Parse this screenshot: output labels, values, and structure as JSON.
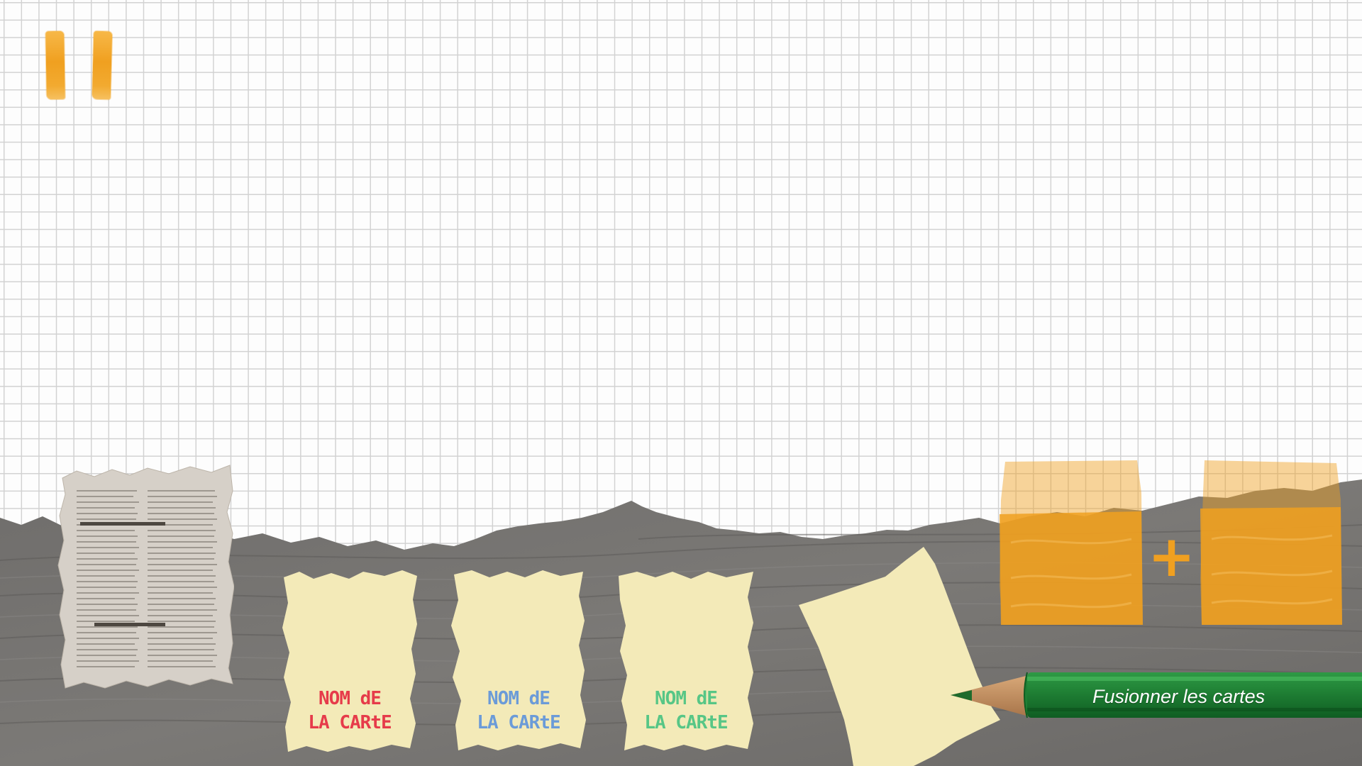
{
  "pause_button": {
    "icon": "pause-icon"
  },
  "deck": {
    "icon": "newspaper-card-icon"
  },
  "hand": {
    "cards": [
      {
        "label_line1": "NOM dE",
        "label_line2": "LA CARtE",
        "color": "#e63b4a"
      },
      {
        "label_line1": "NOM dE",
        "label_line2": "LA CARtE",
        "color": "#6b9bd8"
      },
      {
        "label_line1": "NOM dE",
        "label_line2": "LA CARtE",
        "color": "#57c686"
      }
    ]
  },
  "blank_card": {
    "icon": "blank-card-icon"
  },
  "merge": {
    "button_label": "Fusionner les cartes",
    "plus": "+",
    "accent_color": "#f0a020"
  }
}
